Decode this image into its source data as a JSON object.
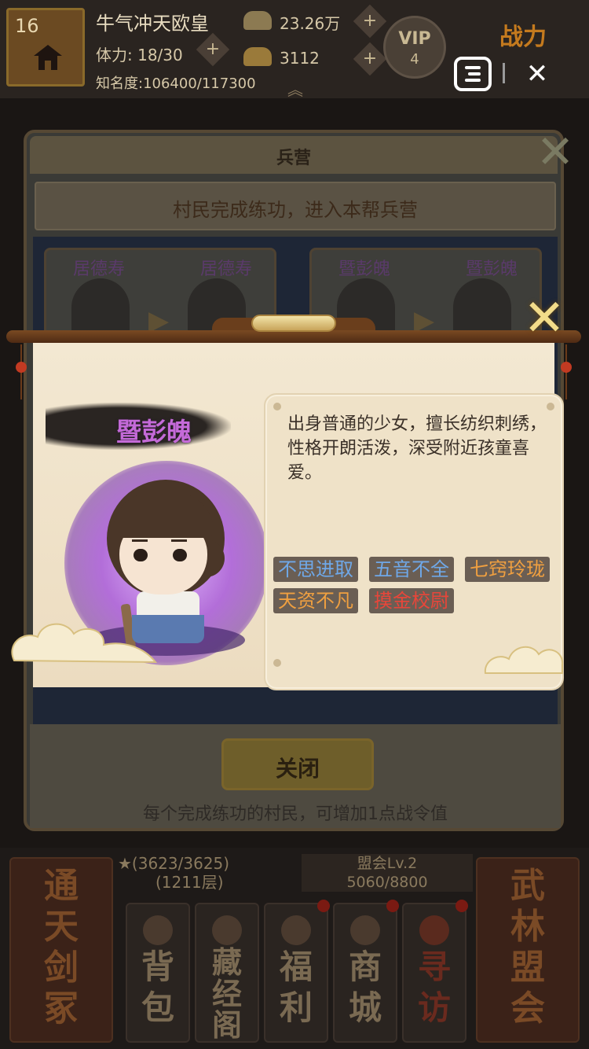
{
  "hud": {
    "level": "16",
    "player_name": "牛气冲天欧皇",
    "stamina": "体力: 18/30",
    "fame": "知名度:106400/117300",
    "silver": "23.26万",
    "gold": "3112",
    "vip_label": "VIP",
    "vip_level": "4",
    "power_label": "战力",
    "plus": "+",
    "chevron": "︽"
  },
  "mini_program": {
    "close_glyph": "✕"
  },
  "barracks_panel": {
    "title": "兵营",
    "close_glyph": "✕",
    "banner": "村民完成练功，进入本帮兵营",
    "cards": [
      {
        "from": "居德寿",
        "to": "居德寿"
      },
      {
        "from": "暨彭魄",
        "to": "暨彭魄"
      }
    ],
    "arrow": "▶",
    "close_button": "关闭",
    "footnote": "每个完成练功的村民，可增加1点战令值"
  },
  "character_popup": {
    "close_glyph": "✕",
    "name": "暨彭魄",
    "name_color": "#c46ad8",
    "description": "出身普通的少女，擅长纺织刺绣，性格开朗活泼，深受附近孩童喜爱。",
    "traits": [
      {
        "label": "不思进取",
        "color": "#6fa8e8"
      },
      {
        "label": "五音不全",
        "color": "#6fa8e8"
      },
      {
        "label": "七窍玲珑",
        "color": "#f0a040"
      },
      {
        "label": "天资不凡",
        "color": "#f0a040"
      },
      {
        "label": "摸金校尉",
        "color": "#e8463a"
      }
    ]
  },
  "bottom_nav": {
    "left_big": [
      "通",
      "天",
      "剑",
      "冢"
    ],
    "stars": "★(3623/3625)",
    "floors": "(1211层)",
    "alliance_title": "盟会Lv.2",
    "alliance_progress": "5060/8800",
    "buttons": [
      {
        "label": [
          "背",
          "包"
        ]
      },
      {
        "label": [
          "藏",
          "经",
          "阁"
        ]
      },
      {
        "label": [
          "福",
          "利"
        ]
      },
      {
        "label": [
          "商",
          "城"
        ]
      },
      {
        "label": [
          "寻",
          "访"
        ]
      }
    ],
    "right_big": [
      "武",
      "林",
      "盟",
      "会"
    ]
  }
}
